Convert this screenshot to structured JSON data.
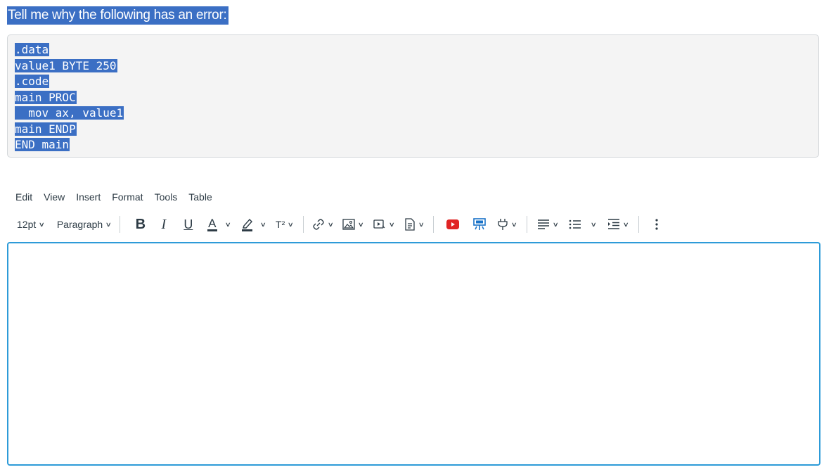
{
  "prompt": {
    "text": "Tell me why the following has an error:"
  },
  "code": {
    "lines": [
      ".data",
      "value1 BYTE 250",
      ".code",
      "main PROC",
      "  mov ax, value1",
      "main ENDP",
      "END main"
    ]
  },
  "menubar": {
    "items": [
      "Edit",
      "View",
      "Insert",
      "Format",
      "Tools",
      "Table"
    ]
  },
  "toolbar": {
    "font_size": "12pt",
    "block_format": "Paragraph",
    "bold_glyph": "B",
    "italic_glyph": "I",
    "underline_glyph": "U",
    "text_color_glyph": "A",
    "superscript_glyph": "T²"
  },
  "colors": {
    "selection": "#3b6fc4",
    "editor_focus_border": "#2d9bd8",
    "youtube_red": "#e02424",
    "plugin_blue": "#1a73c8"
  },
  "editor": {
    "value": ""
  }
}
